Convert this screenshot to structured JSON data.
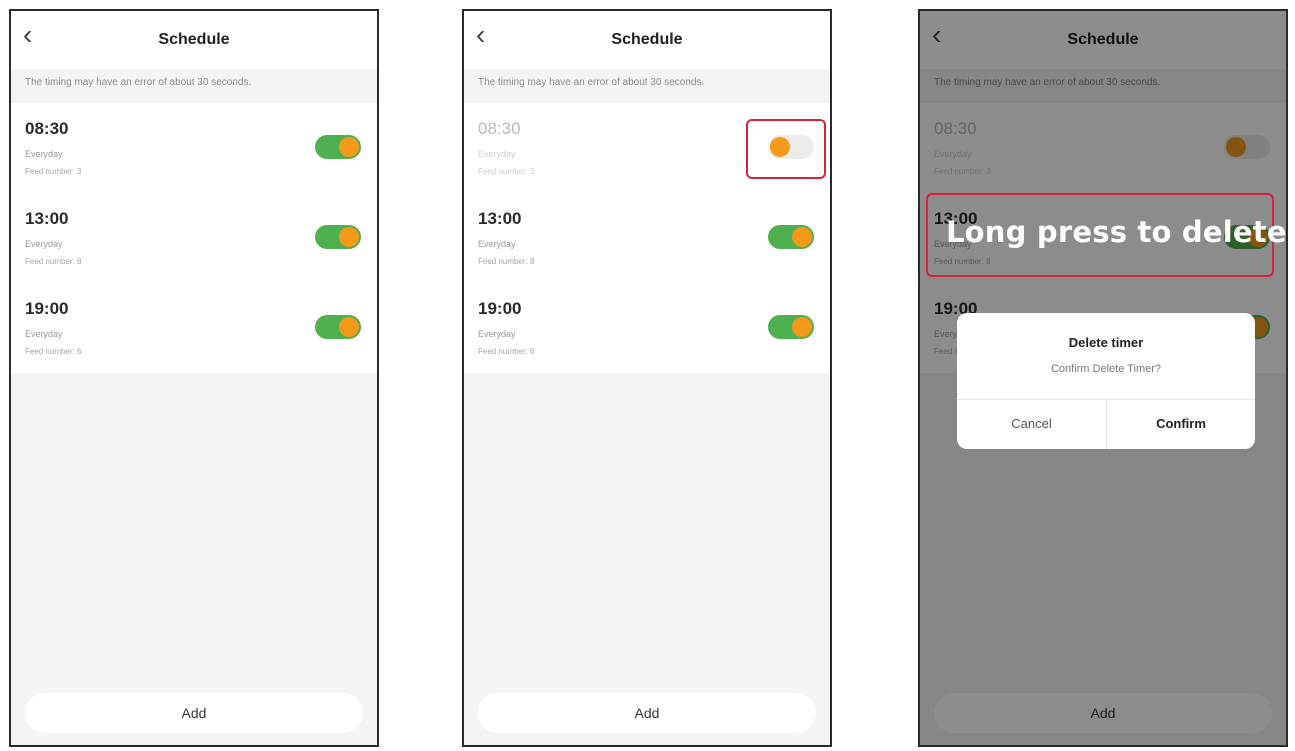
{
  "screens": [
    {
      "header": {
        "back_glyph": "‹",
        "title": "Schedule"
      },
      "notice": "The timing may have an error of about 30 seconds.",
      "timers": [
        {
          "time": "08:30",
          "repeat": "Everyday",
          "feed": "Feed number: 3",
          "enabled": true
        },
        {
          "time": "13:00",
          "repeat": "Everyday",
          "feed": "Feed number: 8",
          "enabled": true
        },
        {
          "time": "19:00",
          "repeat": "Everyday",
          "feed": "Feed number: 6",
          "enabled": true
        }
      ],
      "add_label": "Add"
    },
    {
      "header": {
        "back_glyph": "‹",
        "title": "Schedule"
      },
      "notice": "The timing may have an error of about 30 seconds.",
      "timers": [
        {
          "time": "08:30",
          "repeat": "Everyday",
          "feed": "Feed number: 3",
          "enabled": false
        },
        {
          "time": "13:00",
          "repeat": "Everyday",
          "feed": "Feed number: 8",
          "enabled": true
        },
        {
          "time": "19:00",
          "repeat": "Everyday",
          "feed": "Feed number: 6",
          "enabled": true
        }
      ],
      "add_label": "Add"
    },
    {
      "header": {
        "back_glyph": "‹",
        "title": "Schedule"
      },
      "notice": "The timing may have an error of about 30 seconds.",
      "timers": [
        {
          "time": "08:30",
          "repeat": "Everyday",
          "feed": "Feed number: 3",
          "enabled": false
        },
        {
          "time": "13:00",
          "repeat": "Everyday",
          "feed": "Feed number: 8",
          "enabled": true
        },
        {
          "time": "19:00",
          "repeat": "Everyday",
          "feed": "Feed number: 6",
          "enabled": true
        }
      ],
      "add_label": "Add",
      "annotation": "Long press to delete",
      "dialog": {
        "title": "Delete timer",
        "message": "Confirm Delete Timer?",
        "cancel": "Cancel",
        "confirm": "Confirm"
      }
    }
  ],
  "colors": {
    "toggle_on": "#4fb04f",
    "toggle_knob": "#f39a1b",
    "toggle_off": "#ececec",
    "highlight": "#d6233a",
    "overlay": "rgba(0,0,0,0.45)"
  }
}
